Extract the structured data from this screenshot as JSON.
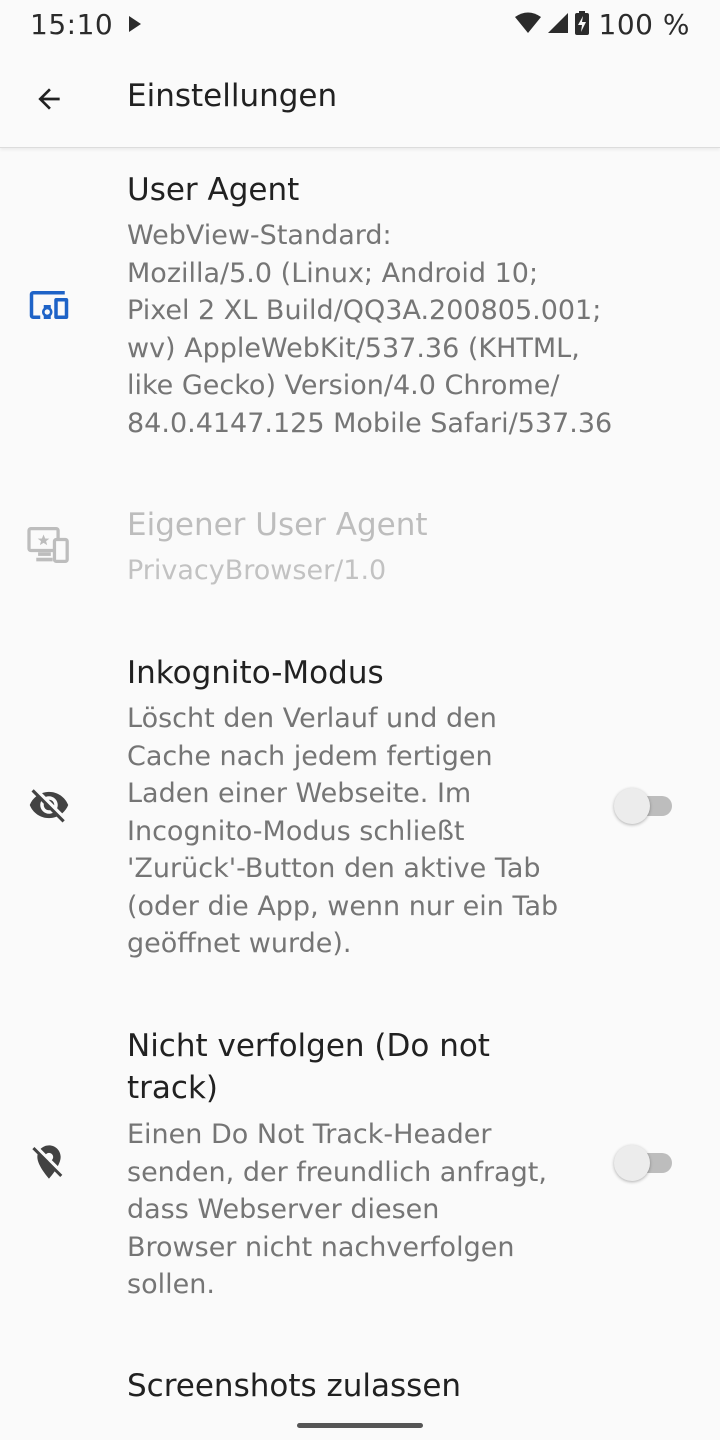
{
  "status_bar": {
    "time": "15:10",
    "battery": "100 %"
  },
  "app_bar": {
    "title": "Einstellungen"
  },
  "prefs": [
    {
      "title": "User Agent",
      "summary_lines": [
        "WebView-Standard:",
        "Mozilla/5.0 (Linux; Android 10;",
        "Pixel 2 XL Build/QQ3A.200805.001;",
        "wv) AppleWebKit/537.36 (KHTML,",
        "like Gecko) Version/4.0 Chrome/",
        "84.0.4147.125 Mobile Safari/537.36"
      ],
      "icon": "devices-icon",
      "enabled": true
    },
    {
      "title": "Eigener User Agent",
      "summary_lines": [
        "PrivacyBrowser/1.0"
      ],
      "icon": "custom-display-icon",
      "enabled": false
    },
    {
      "title": "Inkognito-Modus",
      "summary_lines": [
        "Löscht den Verlauf und den",
        "Cache nach jedem fertigen",
        "Laden einer Webseite. Im",
        "Incognito-Modus schließt",
        "'Zurück'-Button den aktive Tab",
        "(oder die App, wenn nur ein Tab",
        "geöffnet wurde)."
      ],
      "icon": "visibility-off-icon",
      "enabled": true,
      "switch_on": false
    },
    {
      "title_lines": [
        "Nicht verfolgen (Do not",
        "track)"
      ],
      "summary_lines": [
        "Einen Do Not Track-Header",
        "senden, der freundlich anfragt,",
        "dass Webserver diesen",
        "Browser nicht nachverfolgen",
        "sollen."
      ],
      "icon": "location-off-icon",
      "enabled": true,
      "switch_on": false
    },
    {
      "title": "Screenshots zulassen"
    }
  ],
  "colors": {
    "accent": "#1e63c7",
    "disabled_icon": "#bdbdbd",
    "icon": "#424242"
  }
}
